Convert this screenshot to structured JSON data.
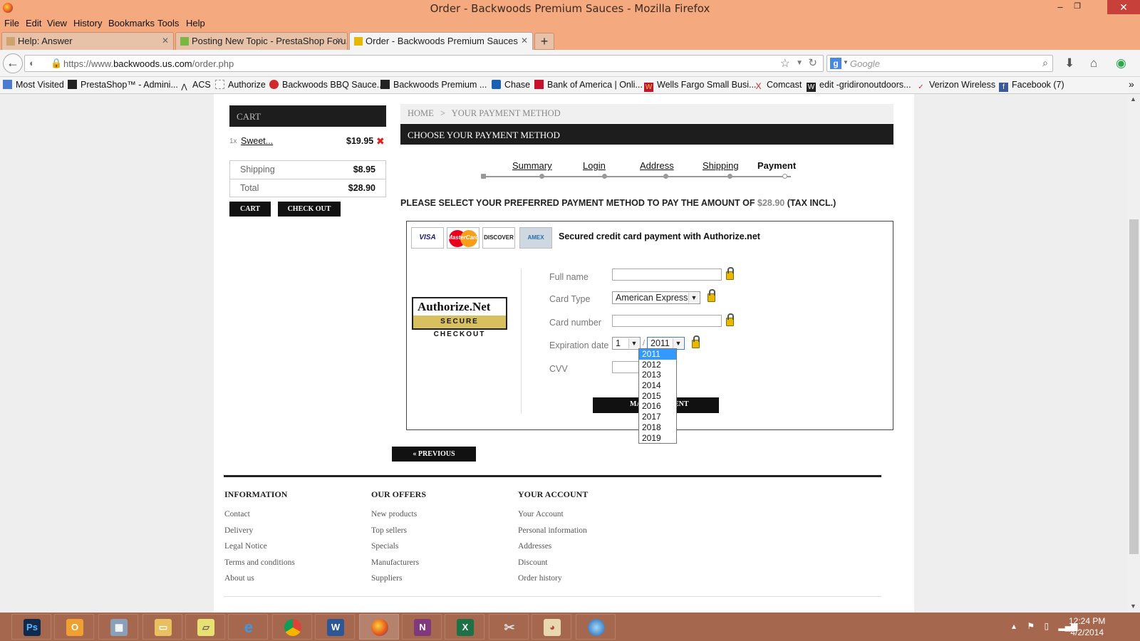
{
  "window": {
    "title": "Order - Backwoods Premium Sauces - Mozilla Firefox",
    "minimize": "–",
    "maximize": "❐",
    "close": "✕"
  },
  "menu": [
    "File",
    "Edit",
    "View",
    "History",
    "Bookmarks",
    "Tools",
    "Help"
  ],
  "tabs": [
    {
      "label": "Help: Answer",
      "close": "✕"
    },
    {
      "label": "Posting New Topic - PrestaShop Foru...",
      "close": "✕"
    },
    {
      "label": "Order - Backwoods Premium Sauces",
      "close": "✕"
    }
  ],
  "newtab": "+",
  "nav": {
    "url_prefix": "https://www.",
    "url_domain": "backwoods.us.com",
    "url_path": "/order.php",
    "search_placeholder": "Google",
    "search_engine": "g"
  },
  "bookmarks": [
    "Most Visited",
    "PrestaShop™ - Admini...",
    "ACS",
    "Authorize",
    "Backwoods BBQ Sauce...",
    "Backwoods Premium ...",
    "Chase",
    "Bank of America | Onli...",
    "Wells Fargo Small Busi...",
    "Comcast",
    "edit -gridironoutdoors...",
    "Verizon Wireless",
    "Facebook (7)"
  ],
  "bookmark_more": "»",
  "cart": {
    "title": "CART",
    "qty": "1x",
    "item_name": "Sweet...",
    "item_price": "$19.95",
    "remove": "✖",
    "shipping_label": "Shipping",
    "shipping_value": "$8.95",
    "total_label": "Total",
    "total_value": "$28.90",
    "cart_button": "CART",
    "checkout_button": "CHECK OUT"
  },
  "breadcrumb": {
    "home": "HOME",
    "sep": ">",
    "current": "YOUR PAYMENT METHOD"
  },
  "heading": "CHOOSE YOUR PAYMENT METHOD",
  "steps": [
    "Summary",
    "Login",
    "Address",
    "Shipping",
    "Payment"
  ],
  "instruction": {
    "text": "PLEASE SELECT YOUR PREFERRED PAYMENT METHOD TO PAY THE AMOUNT OF",
    "amount": "$28.90",
    "suffix": "(TAX INCL.)"
  },
  "payment": {
    "title": "Secured credit card payment with Authorize.net",
    "cards": [
      "VISA",
      "MasterCard",
      "DISCOVER",
      "AMEX"
    ],
    "auth_logo_top": "Authorize.Net",
    "auth_logo_bottom": "SECURE CHECKOUT",
    "fullname_label": "Full name",
    "fullname_value": "",
    "cardtype_label": "Card Type",
    "cardtype_value": "American Express",
    "cardnumber_label": "Card number",
    "cardnumber_value": "",
    "expiration_label": "Expiration date",
    "exp_month": "1",
    "exp_sep": "/",
    "exp_year": "2011",
    "cvv_label": "CVV",
    "cvv_value": "",
    "make_payment": "MAKE PAYMENT",
    "year_options": [
      "2011",
      "2012",
      "2013",
      "2014",
      "2015",
      "2016",
      "2017",
      "2018",
      "2019"
    ]
  },
  "previous_button": "« PREVIOUS",
  "footer": {
    "columns": [
      {
        "title": "INFORMATION",
        "links": [
          "Contact",
          "Delivery",
          "Legal Notice",
          "Terms and conditions",
          "About us"
        ]
      },
      {
        "title": "OUR OFFERS",
        "links": [
          "New products",
          "Top sellers",
          "Specials",
          "Manufacturers",
          "Suppliers"
        ]
      },
      {
        "title": "YOUR ACCOUNT",
        "links": [
          "Your Account",
          "Personal information",
          "Addresses",
          "Discount",
          "Order history"
        ]
      }
    ]
  },
  "taskbar": {
    "apps": [
      "Ps",
      "Outlook",
      "Calculator",
      "Explorer",
      "Notes",
      "IE",
      "Chrome",
      "W",
      "Firefox",
      "N",
      "X",
      "Snip",
      "Paint",
      "Media"
    ],
    "time": "12:24 PM",
    "date": "4/2/2014"
  },
  "colors": {
    "accent_bar": "#f5a97e",
    "taskbar": "#a5684e",
    "dark": "#1d1d1d"
  }
}
